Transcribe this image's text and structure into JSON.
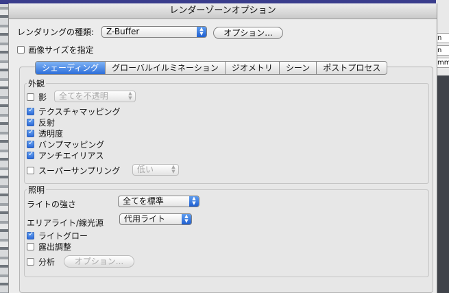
{
  "window": {
    "title": "レンダーゾーンオプション"
  },
  "right_fragments": [
    "n",
    "n",
    "mm"
  ],
  "renderer": {
    "label": "レンダリングの種類:",
    "value": "Z-Buffer",
    "options_button": "オプション..."
  },
  "image_size": {
    "label": "画像サイズを指定",
    "checked": false
  },
  "tabs": [
    {
      "label": "シェーディング",
      "active": true
    },
    {
      "label": "グローバルイルミネーション",
      "active": false
    },
    {
      "label": "ジオメトリ",
      "active": false
    },
    {
      "label": "シーン",
      "active": false
    },
    {
      "label": "ポストプロセス",
      "active": false
    }
  ],
  "appearance": {
    "title": "外観",
    "shadow": {
      "label": "影",
      "checked": false,
      "popup": "全てを不透明"
    },
    "items": [
      {
        "label": "テクスチャマッピング",
        "checked": true
      },
      {
        "label": "反射",
        "checked": true
      },
      {
        "label": "透明度",
        "checked": true
      },
      {
        "label": "バンプマッピング",
        "checked": true
      },
      {
        "label": "アンチエイリアス",
        "checked": true
      }
    ],
    "supersampling": {
      "label": "スーパーサンプリング",
      "checked": false,
      "popup": "低い"
    }
  },
  "lighting": {
    "title": "照明",
    "intensity": {
      "label": "ライトの強さ",
      "popup": "全てを標準"
    },
    "area_light": {
      "label": "エリアライト/線光源",
      "popup": "代用ライト"
    },
    "light_glow": {
      "label": "ライトグロー",
      "checked": true
    },
    "exposure": {
      "label": "露出調整",
      "checked": false
    },
    "analysis": {
      "label": "分析",
      "checked": false,
      "options_button": "オプション..."
    }
  }
}
